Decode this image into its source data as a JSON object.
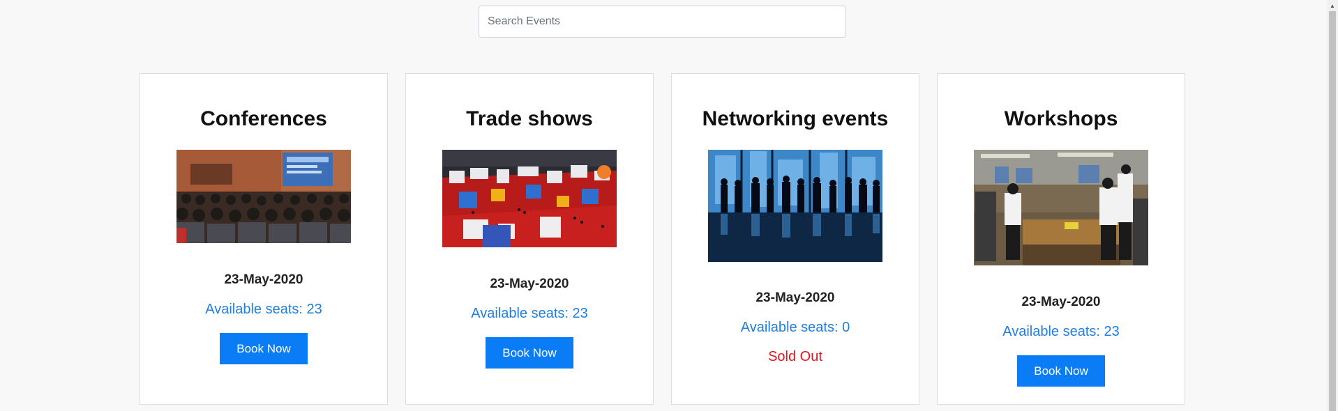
{
  "search": {
    "placeholder": "Search Events",
    "value": ""
  },
  "events": [
    {
      "title": "Conferences",
      "image_icon": "conference-photo",
      "date": "23-May-2020",
      "seats": "Available seats: 23",
      "action_label": "Book Now",
      "sold_out": false
    },
    {
      "title": "Trade shows",
      "image_icon": "trade-show-photo",
      "date": "23-May-2020",
      "seats": "Available seats: 23",
      "action_label": "Book Now",
      "sold_out": false
    },
    {
      "title": "Networking events",
      "image_icon": "networking-photo",
      "date": "23-May-2020",
      "seats": "Available seats: 0",
      "status_label": "Sold Out",
      "sold_out": true
    },
    {
      "title": "Workshops",
      "image_icon": "workshop-photo",
      "date": "23-May-2020",
      "seats": "Available seats: 23",
      "action_label": "Book Now",
      "sold_out": false
    }
  ],
  "colors": {
    "accent": "#0a7cf5",
    "seats_text": "#1e7fe0",
    "sold_out": "#e3141c",
    "background": "#f8f8f8"
  }
}
